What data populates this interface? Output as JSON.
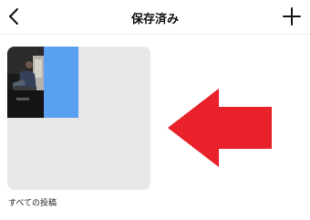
{
  "header": {
    "back_icon": "chevron-left-icon",
    "title": "保存済み",
    "add_icon": "plus-icon"
  },
  "collection": {
    "label": "すべての投稿",
    "thumbnail_accent": "#5aa0f0"
  },
  "annotation": {
    "arrow_icon": "left-arrow-icon",
    "arrow_color": "#e8212a"
  }
}
